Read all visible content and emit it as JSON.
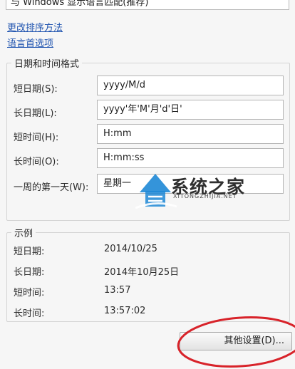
{
  "top_select": {
    "value": "与 Windows 显示语言匹配(推荐)"
  },
  "links": {
    "change_sort": "更改排序方法",
    "language_pref": "语言首选项"
  },
  "datetime_group": {
    "legend": "日期和时间格式",
    "rows": [
      {
        "label": "短日期(S):",
        "value": "yyyy/M/d"
      },
      {
        "label": "长日期(L):",
        "value": "yyyy'年'M'月'd'日'"
      },
      {
        "label": "短时间(H):",
        "value": "H:mm"
      },
      {
        "label": "长时间(O):",
        "value": "H:mm:ss"
      },
      {
        "label": "一周的第一天(W):",
        "value": "星期一"
      }
    ]
  },
  "example_group": {
    "legend": "示例",
    "rows": [
      {
        "label": "短日期:",
        "value": "2014/10/25"
      },
      {
        "label": "长日期:",
        "value": "2014年10月25日"
      },
      {
        "label": "短时间:",
        "value": "13:57"
      },
      {
        "label": "长时间:",
        "value": "13:57:02"
      }
    ]
  },
  "buttons": {
    "other_settings": "其他设置(D)..."
  },
  "watermark": {
    "name": "系统之家",
    "url": "XITONGZHIJIA.NET"
  },
  "colors": {
    "link": "#2155b0",
    "highlight": "#d8232a",
    "watermark_blue": "#1e88d6"
  },
  "icons": {
    "watermark": "house-logo-icon"
  }
}
